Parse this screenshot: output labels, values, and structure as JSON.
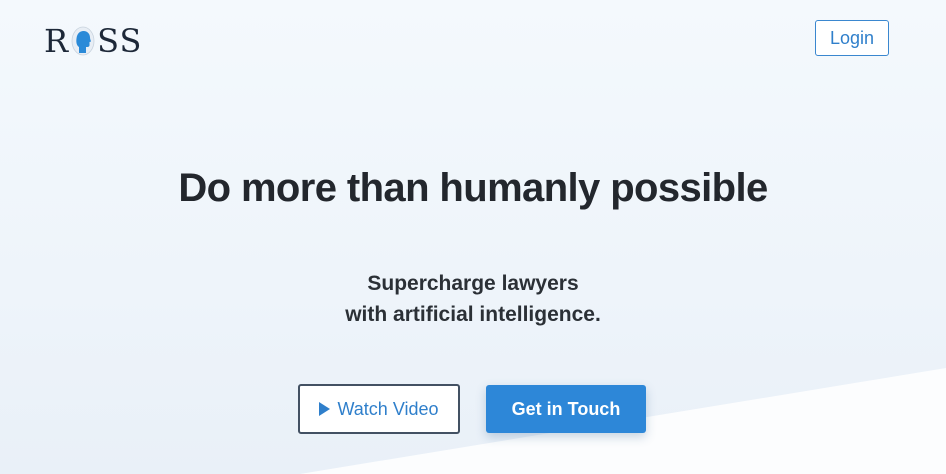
{
  "header": {
    "logo_letters_left": "R",
    "logo_letters_right": "SS",
    "logo_icon": "human-head-icon",
    "login_label": "Login"
  },
  "hero": {
    "title": "Do more than humanly possible",
    "subtitle_line1": "Supercharge lawyers",
    "subtitle_line2": "with artificial intelligence.",
    "watch_video_label": "Watch Video",
    "watch_video_icon": "play-icon",
    "get_in_touch_label": "Get in Touch"
  },
  "colors": {
    "accent": "#2d87d8",
    "link": "#2f7fcb",
    "heading": "#23272d",
    "background": "#eef4fa"
  }
}
